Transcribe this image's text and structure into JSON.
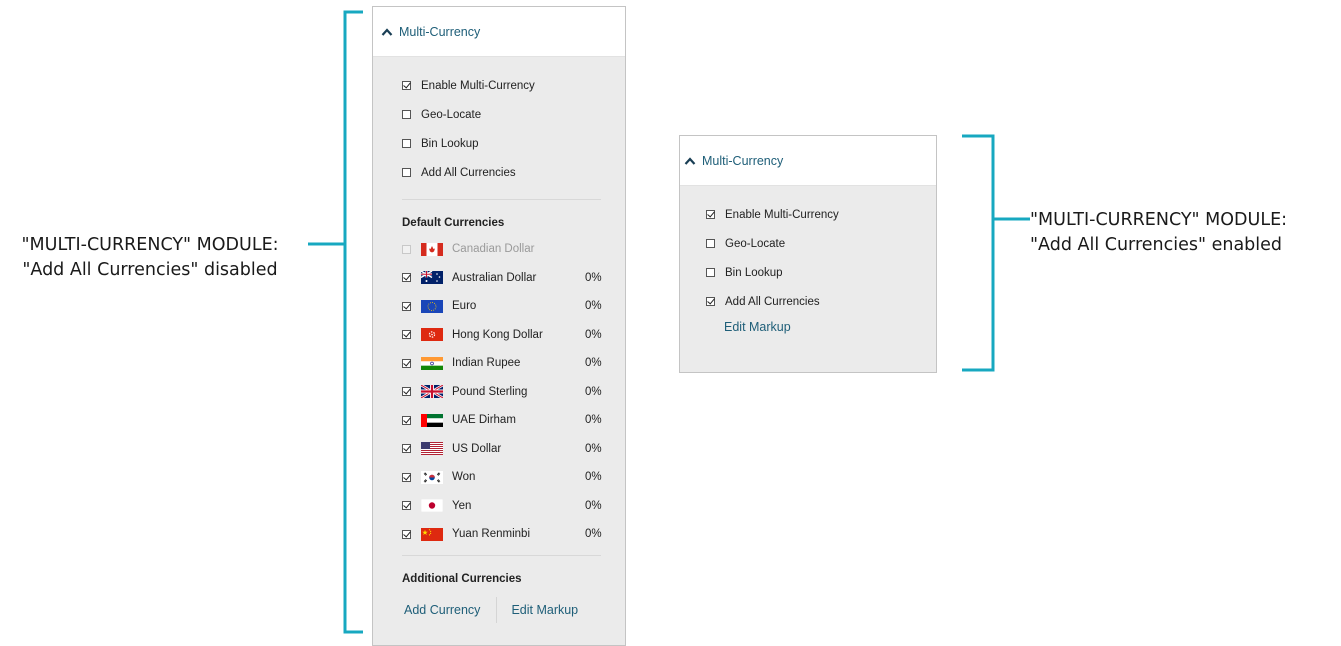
{
  "left_caption": {
    "line1": "\"MULTI-CURRENCY\" MODULE:",
    "line2": "\"Add All Currencies\" disabled"
  },
  "right_caption": {
    "line1": "\"MULTI-CURRENCY\" MODULE:",
    "line2": "\"Add All Currencies\" enabled"
  },
  "left_panel": {
    "title": "Multi-Currency",
    "options": [
      {
        "label": "Enable Multi-Currency",
        "checked": true
      },
      {
        "label": "Geo-Locate",
        "checked": false
      },
      {
        "label": "Bin Lookup",
        "checked": false
      },
      {
        "label": "Add All Currencies",
        "checked": false
      }
    ],
    "default_title": "Default Currencies",
    "currencies": [
      {
        "name": "Canadian Dollar",
        "pct": "",
        "checked": true,
        "disabled": true,
        "flag": "ca-flag-icon"
      },
      {
        "name": "Australian Dollar",
        "pct": "0%",
        "checked": true,
        "flag": "au-flag-icon"
      },
      {
        "name": "Euro",
        "pct": "0%",
        "checked": true,
        "flag": "eu-flag-icon"
      },
      {
        "name": "Hong Kong Dollar",
        "pct": "0%",
        "checked": true,
        "flag": "hk-flag-icon"
      },
      {
        "name": "Indian Rupee",
        "pct": "0%",
        "checked": true,
        "flag": "in-flag-icon"
      },
      {
        "name": "Pound Sterling",
        "pct": "0%",
        "checked": true,
        "flag": "gb-flag-icon"
      },
      {
        "name": "UAE Dirham",
        "pct": "0%",
        "checked": true,
        "flag": "ae-flag-icon"
      },
      {
        "name": "US Dollar",
        "pct": "0%",
        "checked": true,
        "flag": "us-flag-icon"
      },
      {
        "name": "Won",
        "pct": "0%",
        "checked": true,
        "flag": "kr-flag-icon"
      },
      {
        "name": "Yen",
        "pct": "0%",
        "checked": true,
        "flag": "jp-flag-icon"
      },
      {
        "name": "Yuan Renminbi",
        "pct": "0%",
        "checked": true,
        "flag": "cn-flag-icon"
      }
    ],
    "additional_title": "Additional Currencies",
    "add_currency": "Add Currency",
    "edit_markup": "Edit Markup"
  },
  "right_panel": {
    "title": "Multi-Currency",
    "options": [
      {
        "label": "Enable Multi-Currency",
        "checked": true
      },
      {
        "label": "Geo-Locate",
        "checked": false
      },
      {
        "label": "Bin Lookup",
        "checked": false
      },
      {
        "label": "Add All Currencies",
        "checked": true
      }
    ],
    "edit_markup": "Edit Markup"
  },
  "colors": {
    "bracket": "#17a8c0",
    "link": "#1e5e78",
    "panel_bg": "#ebebeb"
  }
}
